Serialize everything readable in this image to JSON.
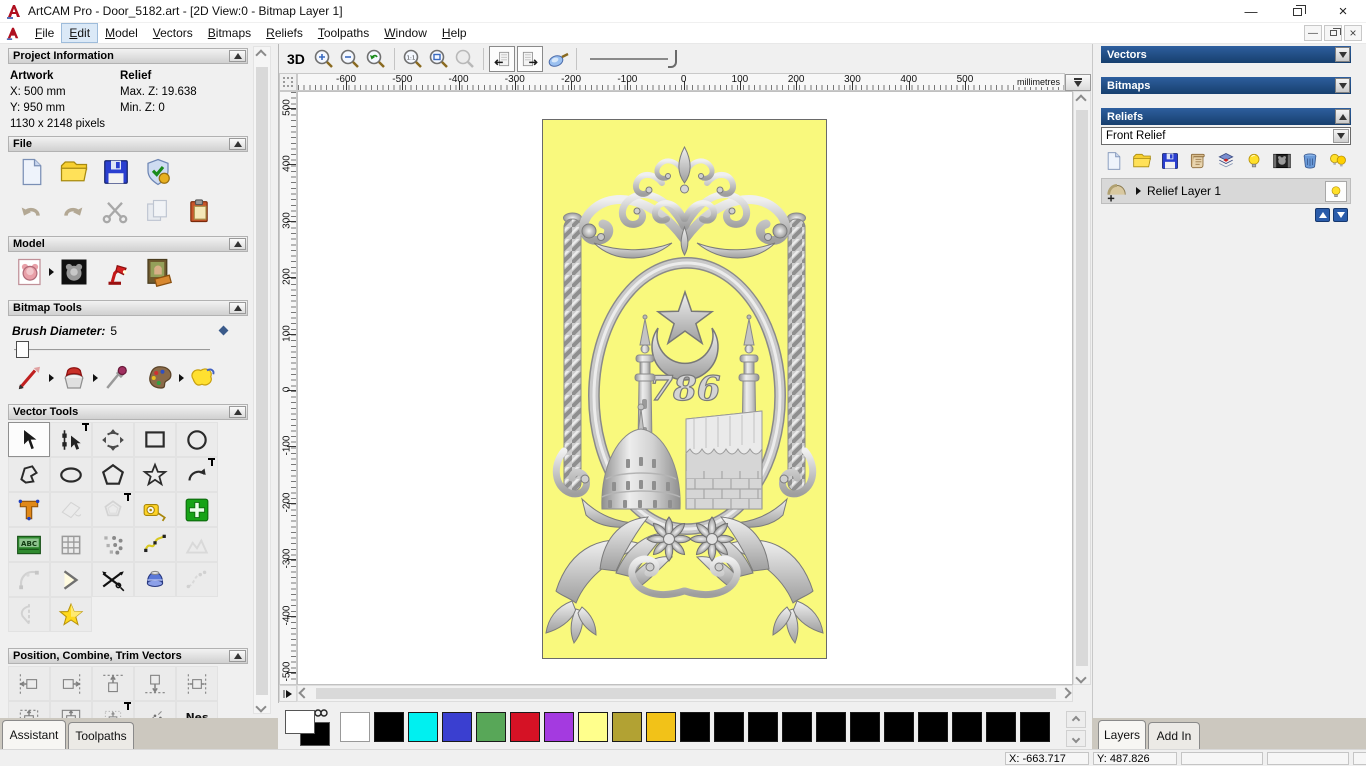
{
  "window": {
    "title": "ArtCAM Pro - Door_5182.art - [2D View:0 - Bitmap Layer 1]"
  },
  "menu": {
    "items": [
      "File",
      "Edit",
      "Model",
      "Vectors",
      "Bitmaps",
      "Reliefs",
      "Toolpaths",
      "Window",
      "Help"
    ],
    "active": "Edit"
  },
  "assistant": {
    "project_info": {
      "title": "Project Information",
      "artwork_heading": "Artwork",
      "relief_heading": "Relief",
      "x": "X: 500 mm",
      "y": "Y: 950 mm",
      "pixels": "1130 x 2148 pixels",
      "max_z": "Max. Z: 19.638",
      "min_z": "Min. Z: 0"
    },
    "file_section": {
      "title": "File",
      "row1": [
        {
          "name": "new-model-icon",
          "kind": "page"
        },
        {
          "name": "open-model-icon",
          "kind": "folder"
        },
        {
          "name": "save-model-icon",
          "kind": "floppy"
        },
        {
          "name": "model-properties-icon",
          "kind": "shield"
        }
      ],
      "row2": [
        {
          "name": "undo-icon",
          "kind": "undo"
        },
        {
          "name": "redo-icon",
          "kind": "redo"
        },
        {
          "name": "cut-icon",
          "kind": "scissors"
        },
        {
          "name": "copy-icon",
          "kind": "copy",
          "disabled": true
        },
        {
          "name": "paste-icon",
          "kind": "paste"
        }
      ]
    },
    "model_section": {
      "title": "Model",
      "icons": [
        {
          "name": "adjust-model-icon",
          "kind": "teddy1",
          "flyout": true
        },
        {
          "name": "invert-model-icon",
          "kind": "teddy2"
        },
        {
          "name": "lighting-icon",
          "kind": "lamp"
        },
        {
          "name": "load-image-icon",
          "kind": "mona"
        }
      ]
    },
    "bitmap_section": {
      "title": "Bitmap Tools",
      "brush_label": "Brush Diameter:",
      "brush_value": "5",
      "icons": [
        {
          "name": "paint-brush-icon",
          "kind": "brush",
          "flyout": true
        },
        {
          "name": "flood-fill-icon",
          "kind": "bucket",
          "flyout": true
        },
        {
          "name": "pick-colour-icon",
          "kind": "dropper"
        },
        {
          "name": "colour-palette-icon",
          "kind": "palette",
          "flyout": true
        },
        {
          "name": "texture-sponge-icon",
          "kind": "sponge"
        }
      ]
    },
    "vector_section": {
      "title": "Vector Tools",
      "rows": [
        [
          {
            "name": "select-vectors-icon",
            "kind": "cursor",
            "active": true
          },
          {
            "name": "node-editing-icon",
            "kind": "nodesel",
            "pin": true
          },
          {
            "name": "transform-vectors-icon",
            "kind": "transform"
          },
          {
            "name": "create-rectangle-icon",
            "kind": "recticon"
          },
          {
            "name": "create-circle-icon",
            "kind": "circleicon"
          }
        ],
        [
          {
            "name": "create-polyline-icon",
            "kind": "freehand"
          },
          {
            "name": "create-ellipse-icon",
            "kind": "ellipseicon"
          },
          {
            "name": "create-polygon-icon",
            "kind": "polygonicon"
          },
          {
            "name": "create-star-icon",
            "kind": "staricon"
          },
          {
            "name": "create-arc-icon",
            "kind": "arcicon",
            "pin": true
          }
        ],
        [
          {
            "name": "create-text-icon",
            "kind": "texticon"
          },
          {
            "name": "vector-boolean-icon",
            "kind": "pour",
            "disabled": true
          },
          {
            "name": "offset-vector-icon",
            "kind": "offsetpoly",
            "disabled": true,
            "pin": true
          },
          {
            "name": "measure-tool-icon",
            "kind": "tape"
          },
          {
            "name": "block-paste-icon",
            "kind": "greencross"
          }
        ],
        [
          {
            "name": "wrap-text-icon",
            "kind": "abc"
          },
          {
            "name": "envelope-distort-icon",
            "kind": "grid"
          },
          {
            "name": "paste-along-curve-icon",
            "kind": "dots"
          },
          {
            "name": "fit-curve-icon",
            "kind": "curvepts"
          },
          {
            "name": "smooth-vectors-icon",
            "kind": "mountains",
            "disabled": true
          }
        ],
        [
          {
            "name": "fit-arcs-icon",
            "kind": "arcfit",
            "disabled": true
          },
          {
            "name": "join-vectors-icon",
            "kind": "chevron"
          },
          {
            "name": "trim-vectors-icon",
            "kind": "trim"
          },
          {
            "name": "revolve-tool-icon",
            "kind": "spinjar"
          },
          {
            "name": "fit-polyline-icon",
            "kind": "pathdots",
            "disabled": true
          }
        ],
        [
          {
            "name": "mirror-vectors-icon",
            "kind": "halfshape",
            "disabled": true
          },
          {
            "name": "vector-doctor-icon",
            "k ind": "goldstar",
            "kind": "goldstar"
          }
        ]
      ]
    },
    "position_section": {
      "title": "Position, Combine, Trim Vectors",
      "rows": [
        [
          {
            "name": "align-left-icon",
            "kind": "alignL"
          },
          {
            "name": "align-right-icon",
            "kind": "alignR"
          },
          {
            "name": "align-top-icon",
            "kind": "alignT"
          },
          {
            "name": "align-bottom-icon",
            "kind": "alignB"
          },
          {
            "name": "center-horizontal-icon",
            "kind": "alignCH"
          }
        ],
        [
          {
            "name": "center-in-page-icon",
            "kind": "centerA"
          },
          {
            "name": "align-centers-icon",
            "kind": "centerB"
          },
          {
            "name": "align-center-vertical-icon",
            "kind": "centerC",
            "pin": true
          },
          {
            "name": "scatter-vectors-icon",
            "kind": "scatter"
          },
          {
            "name": "nest-vectors-icon",
            "kind": "nes"
          }
        ]
      ]
    },
    "tabs": [
      {
        "label": "Assistant",
        "active": true
      },
      {
        "label": "Toolpaths",
        "active": false
      }
    ]
  },
  "view2d": {
    "toolbar": {
      "label_3d": "3D",
      "icons": [
        {
          "name": "zoom-in-icon",
          "kind": "magp"
        },
        {
          "name": "zoom-out-icon",
          "kind": "magm"
        },
        {
          "name": "zoom-previous-icon",
          "kind": "magback"
        },
        {
          "name": "sep"
        },
        {
          "name": "zoom-1to1-icon",
          "kind": "mag11"
        },
        {
          "name": "zoom-fit-icon",
          "kind": "magfit"
        },
        {
          "name": "zoom-selection-icon",
          "kind": "magsel",
          "disabled": true
        },
        {
          "name": "sep"
        },
        {
          "name": "prev-layer-icon",
          "kind": "pageprev",
          "boxed": true
        },
        {
          "name": "next-layer-icon",
          "kind": "pagenext",
          "boxed": true
        },
        {
          "name": "preview-layer-icon",
          "kind": "magside"
        },
        {
          "name": "sep"
        }
      ]
    },
    "ruler": {
      "units": "millimetres",
      "h_ticks": [
        "-600",
        "-500",
        "-400",
        "-300",
        "-200",
        "-100",
        "0",
        "100",
        "200",
        "300",
        "400",
        "500"
      ],
      "v_ticks": [
        "500",
        "400",
        "300",
        "200",
        "100",
        "0",
        "-100",
        "-200",
        "-300",
        "-400",
        "-500"
      ]
    },
    "artwork": {
      "background": "#f9f97d",
      "number_text": "786",
      "elements": [
        "floral-crown",
        "rope-columns",
        "oval-frame",
        "star",
        "crescent",
        "number-786",
        "minarets",
        "mosque-dome",
        "kaaba",
        "flowers",
        "floral-base"
      ]
    }
  },
  "right_panel": {
    "vectors_title": "Vectors",
    "bitmaps_title": "Bitmaps",
    "reliefs": {
      "title": "Reliefs",
      "dropdown_value": "Front Relief",
      "icons": [
        {
          "name": "new-relief-layer-icon",
          "kind": "page"
        },
        {
          "name": "open-relief-icon",
          "kind": "folder"
        },
        {
          "name": "save-relief-icon",
          "kind": "floppy"
        },
        {
          "name": "relief-clipart-icon",
          "kind": "scroll"
        },
        {
          "name": "stack-layers-icon",
          "kind": "layers"
        },
        {
          "name": "toggle-visibility-icon",
          "kind": "bulb"
        },
        {
          "name": "greyscale-view-icon",
          "kind": "imageS"
        },
        {
          "name": "delete-layer-icon",
          "kind": "trash"
        },
        {
          "name": "show-all-layers-icon",
          "kind": "bulbs"
        }
      ],
      "layer_name": "Relief Layer 1"
    },
    "tabs": [
      {
        "label": "Layers",
        "active": true
      },
      {
        "label": "Add In",
        "active": false
      }
    ]
  },
  "palette": {
    "colors": [
      "#ffffff",
      "#000000",
      "#00f0f0",
      "#3a3fd0",
      "#58a758",
      "#d51225",
      "#a43ae0",
      "#ffff8c",
      "#b2a233",
      "#f2c218",
      "#000000",
      "#000000",
      "#000000",
      "#000000",
      "#000000",
      "#000000",
      "#000000",
      "#000000",
      "#000000",
      "#000000",
      "#000000"
    ]
  },
  "status": {
    "x": "X: -663.717",
    "y": "Y: 487.826"
  }
}
